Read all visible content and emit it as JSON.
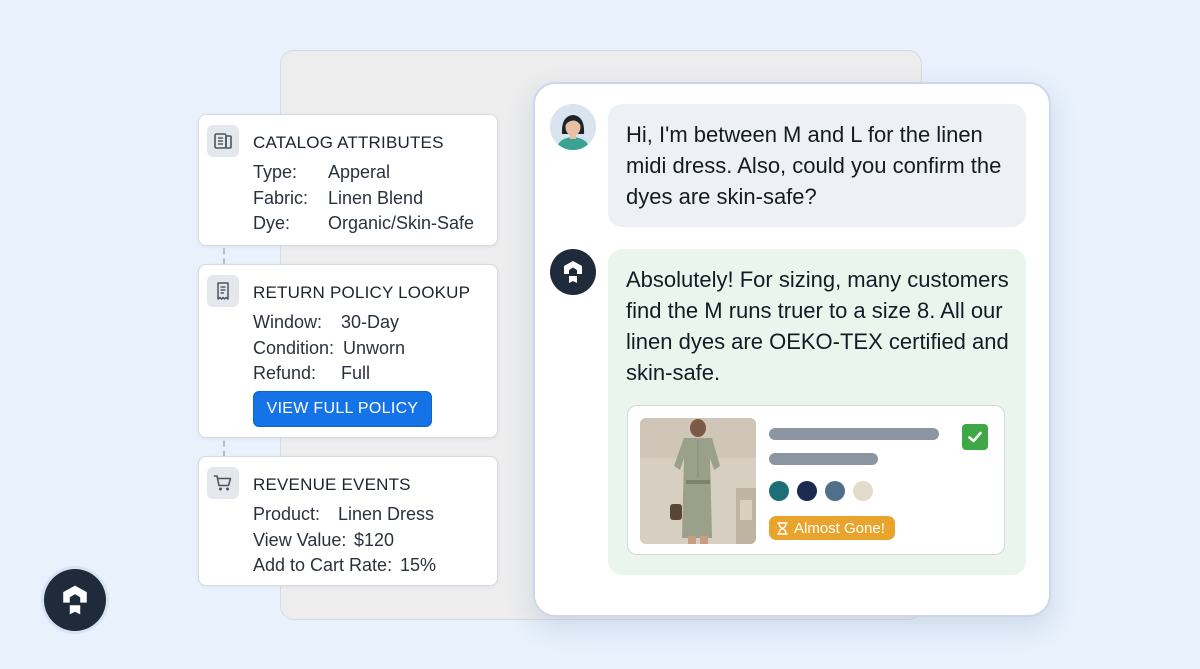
{
  "cards": {
    "catalog": {
      "title": "CATALOG ATTRIBUTES",
      "icon": "catalog-icon",
      "rows": [
        {
          "label": "Type:",
          "value": "Apperal"
        },
        {
          "label": "Fabric:",
          "value": "Linen Blend"
        },
        {
          "label": "Dye:",
          "value": "Organic/Skin-Safe"
        }
      ]
    },
    "return_policy": {
      "title": "RETURN POLICY LOOKUP",
      "icon": "receipt-icon",
      "rows": [
        {
          "label": "Window:",
          "value": "30-Day"
        },
        {
          "label": "Condition:",
          "value": "Unworn"
        },
        {
          "label": "Refund:",
          "value": "Full"
        }
      ],
      "button_label": "VIEW FULL POLICY"
    },
    "revenue": {
      "title": "REVENUE EVENTS",
      "icon": "cart-icon",
      "rows": [
        {
          "label": "Product:",
          "value": "Linen Dress"
        },
        {
          "label": "View Value:",
          "value": "$120"
        },
        {
          "label": "Add to Cart Rate:",
          "value": "15%"
        }
      ]
    }
  },
  "chat": {
    "user_message": "Hi, I'm between M and L for the linen midi dress. Also, could you confirm the dyes are skin-safe?",
    "bot_message": "Absolutely! For sizing, many customers find the M runs truer to a size 8. All our linen dyes are OEKO-TEX certified and skin-safe.",
    "product": {
      "badge": "Almost Gone!",
      "swatches": [
        "#1e6e78",
        "#1b2a4e",
        "#4f6f8a",
        "#e4dccb"
      ],
      "selected": true
    }
  },
  "colors": {
    "accent": "#1473e6",
    "badge": "#e9a42e",
    "check": "#3da845",
    "bot_bubble": "#eaf5ee",
    "user_bubble": "#edf0f5"
  }
}
